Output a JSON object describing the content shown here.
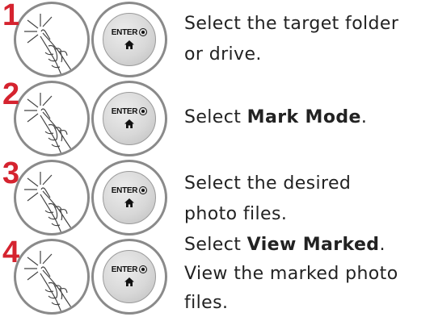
{
  "colors": {
    "step_number": "#d5232f",
    "circle_border": "#8a8a8a",
    "text": "#222222"
  },
  "enter_button_label": "ENTER",
  "icons": [
    "hand-touch-icon",
    "enter-button-icon",
    "ok-dot-icon",
    "home-icon"
  ],
  "steps": [
    {
      "number": "1",
      "line1": "Select the target folder",
      "line2": "or drive."
    },
    {
      "number": "2",
      "line1_prefix": "Select ",
      "line1_bold": "Mark Mode",
      "line1_suffix": "."
    },
    {
      "number": "3",
      "line1": "Select the desired",
      "line2": "photo files."
    },
    {
      "number": "4",
      "line1_prefix": "Select ",
      "line1_bold": "View Marked",
      "line1_suffix": ".",
      "line2": "View the marked photo",
      "line3": "files."
    }
  ]
}
